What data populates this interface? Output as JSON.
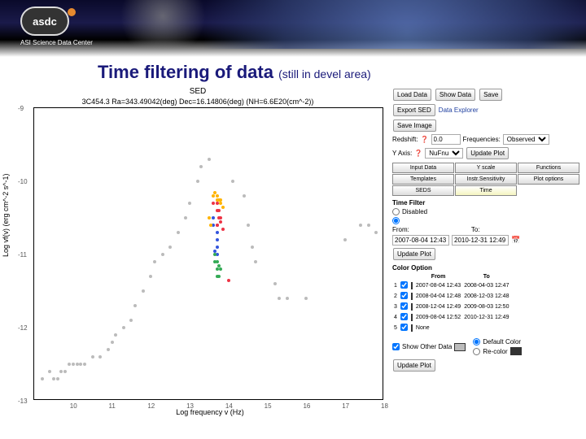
{
  "logo": {
    "mark": "asdc",
    "subtitle": "ASI Science Data Center"
  },
  "title": "Time filtering of data",
  "title_note": "(still in devel area)",
  "chart_data": {
    "type": "scatter",
    "title": "SED",
    "subtitle": "3C454.3 Ra=343.49042(deg) Dec=16.14806(deg) (NH=6.6E20(cm^-2))",
    "xlabel": "Log frequency v (Hz)",
    "ylabel": "Log vf(v) (erg cm^-2 s^-1)",
    "xlim": [
      9,
      18
    ],
    "ylim": [
      -13,
      -9
    ],
    "xticks": [
      10,
      11,
      12,
      13,
      14,
      15,
      16,
      17,
      18
    ],
    "yticks": [
      -13,
      -12,
      -11,
      -10,
      -9
    ],
    "series": [
      {
        "name": "grey",
        "color": "#bbbbbb",
        "points": [
          [
            9.2,
            -12.7
          ],
          [
            9.4,
            -12.6
          ],
          [
            9.5,
            -12.7
          ],
          [
            9.6,
            -12.7
          ],
          [
            9.7,
            -12.6
          ],
          [
            9.8,
            -12.6
          ],
          [
            9.9,
            -12.5
          ],
          [
            10.0,
            -12.5
          ],
          [
            10.1,
            -12.5
          ],
          [
            10.2,
            -12.5
          ],
          [
            10.3,
            -12.5
          ],
          [
            10.5,
            -12.4
          ],
          [
            10.7,
            -12.4
          ],
          [
            10.9,
            -12.3
          ],
          [
            11.0,
            -12.2
          ],
          [
            11.1,
            -12.1
          ],
          [
            11.3,
            -12.0
          ],
          [
            11.5,
            -11.9
          ],
          [
            11.6,
            -11.7
          ],
          [
            11.8,
            -11.5
          ],
          [
            12.0,
            -11.3
          ],
          [
            12.1,
            -11.1
          ],
          [
            12.3,
            -11.0
          ],
          [
            12.5,
            -10.9
          ],
          [
            12.7,
            -10.7
          ],
          [
            12.9,
            -10.5
          ],
          [
            13.0,
            -10.3
          ],
          [
            13.2,
            -10.0
          ],
          [
            13.3,
            -9.8
          ],
          [
            13.5,
            -9.7
          ],
          [
            14.1,
            -10.0
          ],
          [
            14.4,
            -10.2
          ],
          [
            14.5,
            -10.6
          ],
          [
            14.6,
            -10.9
          ],
          [
            14.7,
            -11.1
          ],
          [
            15.2,
            -11.4
          ],
          [
            15.3,
            -11.6
          ],
          [
            15.5,
            -11.6
          ],
          [
            16.0,
            -11.6
          ],
          [
            17.0,
            -10.8
          ],
          [
            17.4,
            -10.6
          ],
          [
            17.6,
            -10.6
          ],
          [
            17.8,
            -10.7
          ]
        ]
      },
      {
        "name": "2007-08-04",
        "color": "#3355dd",
        "points": [
          [
            13.6,
            -10.5
          ],
          [
            13.6,
            -10.6
          ],
          [
            13.7,
            -10.6
          ],
          [
            13.7,
            -10.7
          ],
          [
            13.7,
            -10.8
          ],
          [
            13.7,
            -10.9
          ],
          [
            13.65,
            -10.95
          ],
          [
            13.7,
            -11.0
          ]
        ]
      },
      {
        "name": "2008-04-04",
        "color": "#33aa55",
        "points": [
          [
            13.65,
            -11.0
          ],
          [
            13.65,
            -11.1
          ],
          [
            13.7,
            -11.1
          ],
          [
            13.7,
            -11.2
          ],
          [
            13.75,
            -11.15
          ],
          [
            13.8,
            -11.2
          ],
          [
            13.7,
            -11.3
          ],
          [
            13.75,
            -11.3
          ]
        ]
      },
      {
        "name": "2008-12-04",
        "color": "#ee3344",
        "points": [
          [
            13.6,
            -10.3
          ],
          [
            13.7,
            -10.3
          ],
          [
            13.7,
            -10.4
          ],
          [
            13.75,
            -10.4
          ],
          [
            13.75,
            -10.5
          ],
          [
            13.8,
            -10.5
          ],
          [
            13.8,
            -10.55
          ],
          [
            13.7,
            -10.6
          ],
          [
            13.85,
            -10.65
          ],
          [
            14.0,
            -11.35
          ]
        ]
      },
      {
        "name": "2009-08-04",
        "color": "#ffb400",
        "points": [
          [
            13.6,
            -10.2
          ],
          [
            13.65,
            -10.15
          ],
          [
            13.7,
            -10.2
          ],
          [
            13.7,
            -10.25
          ],
          [
            13.75,
            -10.25
          ],
          [
            13.8,
            -10.25
          ],
          [
            13.8,
            -10.3
          ],
          [
            13.85,
            -10.35
          ],
          [
            13.5,
            -10.5
          ],
          [
            13.55,
            -10.6
          ]
        ]
      }
    ]
  },
  "sidebar": {
    "buttons": {
      "load": "Load Data",
      "show": "Show Data",
      "save": "Save",
      "export": "Export SED",
      "saveimg": "Save Image",
      "update": "Update Plot",
      "update2": "Update Plot"
    },
    "links": {
      "explorer": "Data Explorer"
    },
    "labels": {
      "redshift": "Redshift:",
      "freq": "Frequencies:",
      "yaxis": "Y Axis:",
      "timefilter": "Time Filter",
      "disabled": "Disabled",
      "from": "From:",
      "to": "To:",
      "coloroption": "Color Option",
      "fromh": "From",
      "toh": "To",
      "showother": "Show Other Data",
      "defcolor": "Default Color",
      "recol": "Re-color"
    },
    "redshift_value": "0.0",
    "freq_mode": "Observed",
    "yaxis_mode": "NuFnu",
    "tabs": [
      "Input Data",
      "Y scale",
      "Functions",
      "Templates",
      "Instr.Sensitivity",
      "Plot options",
      "SEDS",
      "Time"
    ],
    "active_tab": "Time",
    "time_from": "2007-08-04 12:43",
    "time_to": "2010-12-31 12:49",
    "color_table": [
      {
        "n": "1",
        "swatch": "#3355dd",
        "from": "2007-08-04 12:43",
        "to": "2008-04-03 12:47"
      },
      {
        "n": "2",
        "swatch": "#33aa55",
        "from": "2008-04-04 12:48",
        "to": "2008-12-03 12:48"
      },
      {
        "n": "3",
        "swatch": "#ee3344",
        "from": "2008-12-04 12:49",
        "to": "2009-08-03 12:50"
      },
      {
        "n": "4",
        "swatch": "#ffb400",
        "from": "2009-08-04 12:52",
        "to": "2010-12-31 12:49"
      },
      {
        "n": "5",
        "swatch": "#777777",
        "from": "None",
        "to": ""
      }
    ],
    "extra_swatch": "#bbbbbb",
    "extra_swatch2": "#333333"
  }
}
